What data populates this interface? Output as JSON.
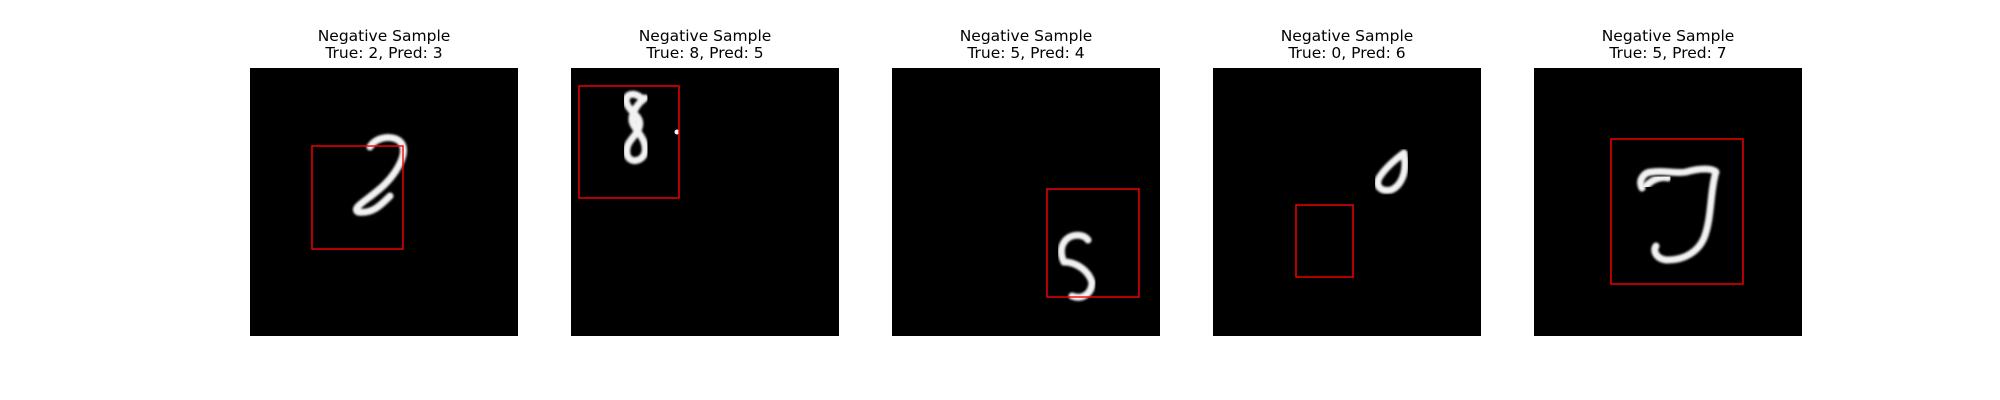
{
  "panels": [
    {
      "title_line1": "Negative Sample",
      "title_line2": "True: 2, Pred: 3",
      "true_label": 2,
      "pred_label": 3
    },
    {
      "title_line1": "Negative Sample",
      "title_line2": "True: 8, Pred: 5",
      "true_label": 8,
      "pred_label": 5
    },
    {
      "title_line1": "Negative Sample",
      "title_line2": "True: 5, Pred: 4",
      "true_label": 5,
      "pred_label": 4
    },
    {
      "title_line1": "Negative Sample",
      "title_line2": "True: 0, Pred: 6",
      "true_label": 0,
      "pred_label": 6
    },
    {
      "title_line1": "Negative Sample",
      "title_line2": "True: 5, Pred: 7",
      "true_label": 5,
      "pred_label": 7
    }
  ],
  "colors": {
    "image_background": "#000000",
    "digit": "#f2f2f2",
    "prediction_box": "#ff0000",
    "page_background": "#ffffff"
  }
}
